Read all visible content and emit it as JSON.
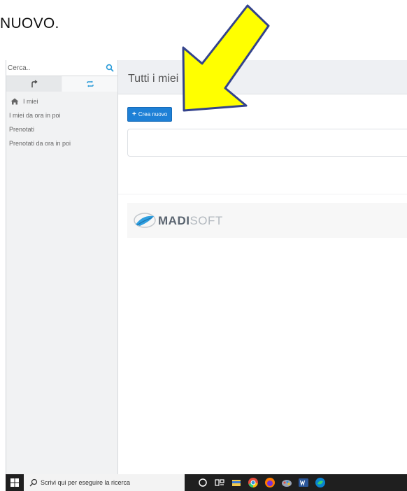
{
  "doc": {
    "text": "NUOVO."
  },
  "sidebar": {
    "search_placeholder": "Cerca..",
    "tabs": [
      {
        "icon": "share-icon"
      },
      {
        "icon": "refresh-icon"
      }
    ],
    "items": [
      {
        "label": "I miei",
        "icon": "home-icon"
      },
      {
        "label": "I miei da ora in poi"
      },
      {
        "label": "Prenotati"
      },
      {
        "label": "Prenotati da ora in poi"
      }
    ]
  },
  "main": {
    "title": "Tutti i miei          qui",
    "create_button": "Crea nuovo"
  },
  "logo": {
    "part1": "MADI",
    "part2": "SOFT"
  },
  "taskbar": {
    "search_placeholder": "Scrivi qui per eseguire la ricerca",
    "icons": [
      "cortana-icon",
      "task-view-icon",
      "file-explorer-icon",
      "chrome-icon",
      "firefox-icon",
      "paint-icon",
      "word-icon",
      "edge-icon"
    ]
  },
  "colors": {
    "accent": "#1e80d6",
    "arrow": "#ffff00",
    "arrow_border": "#34438c"
  }
}
